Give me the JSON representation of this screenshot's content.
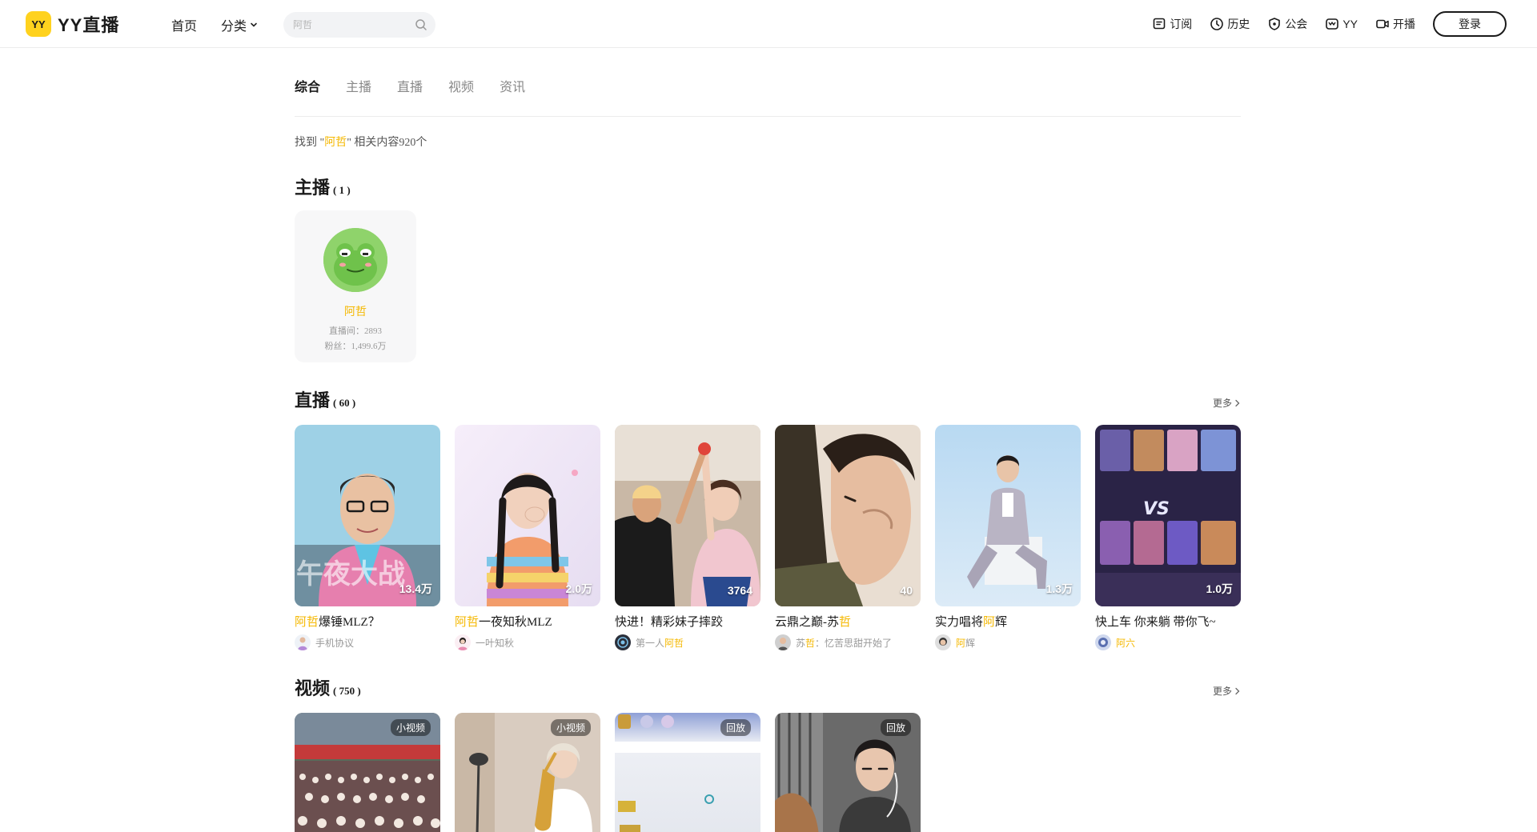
{
  "header": {
    "logo_badge": "YY",
    "logo_text": "YY直播",
    "nav": {
      "home": "首页",
      "category": "分类"
    },
    "search": {
      "placeholder": "阿哲",
      "value": ""
    },
    "right": [
      {
        "icon": "subscribe-icon",
        "label": "订阅"
      },
      {
        "icon": "history-icon",
        "label": "历史"
      },
      {
        "icon": "guild-icon",
        "label": "公会"
      },
      {
        "icon": "yy-icon",
        "label": "YY"
      },
      {
        "icon": "broadcast-icon",
        "label": "开播"
      }
    ],
    "login_label": "登录"
  },
  "tabs": [
    {
      "label": "综合",
      "active": true
    },
    {
      "label": "主播",
      "active": false
    },
    {
      "label": "直播",
      "active": false
    },
    {
      "label": "视频",
      "active": false
    },
    {
      "label": "资讯",
      "active": false
    }
  ],
  "result": {
    "prefix": "找到 \"",
    "keyword": "阿哲",
    "suffix": "\" 相关内容920个"
  },
  "anchor_section": {
    "title": "主播",
    "count": "( 1 )",
    "card": {
      "name": "阿哲",
      "room": "直播间：2893",
      "fans": "粉丝：1,499.6万"
    }
  },
  "live_section": {
    "title": "直播",
    "count": "( 60 )",
    "more": "更多",
    "items": [
      {
        "title_hl": "阿哲",
        "title_rest": "爆锤MLZ？",
        "count": "13.4万",
        "owner_hl": "",
        "owner_rest": "手机协议"
      },
      {
        "title_hl": "阿哲",
        "title_rest": "一夜知秋MLZ",
        "count": "2.0万",
        "owner_hl": "",
        "owner_rest": "一叶知秋"
      },
      {
        "title_pre": "快进！精彩妹子摔跤",
        "count": "3764",
        "owner_pre": "第一人",
        "owner_hl": "阿哲"
      },
      {
        "title_pre": "云鼎之巅-苏",
        "title_hl": "哲",
        "count": "40",
        "owner_pre": "苏",
        "owner_hl": "哲",
        "owner_rest": "：忆苦思甜开始了"
      },
      {
        "title_pre": "实力唱将",
        "title_hl": "阿",
        "title_rest": "辉",
        "count": "1.3万",
        "owner_hl": "阿",
        "owner_rest": "辉"
      },
      {
        "title_pre": "快上车 你来躺 带你飞~",
        "count": "1.0万",
        "owner_hl": "阿",
        "owner_rest": "六"
      }
    ]
  },
  "video_section": {
    "title": "视频",
    "count": "( 750 )",
    "more": "更多",
    "items": [
      {
        "tag": "小视频"
      },
      {
        "tag": "小视频"
      },
      {
        "tag": "回放"
      },
      {
        "tag": "回放"
      }
    ]
  },
  "colors": {
    "brand_yellow": "#ffd21e",
    "highlight": "#f5b800",
    "text": "#1a1a1a",
    "muted": "#999999"
  }
}
